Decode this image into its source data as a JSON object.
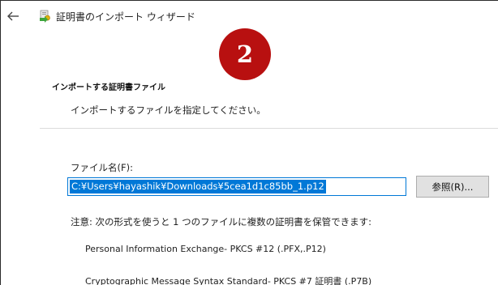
{
  "window": {
    "title": "証明書のインポート ウィザード",
    "back_icon": "back-arrow-icon",
    "app_icon": "certificate-wizard-icon"
  },
  "step_badge": {
    "number": "2",
    "color": "#b81010"
  },
  "section": {
    "heading": "インポートする証明書ファイル",
    "description": "インポートするファイルを指定してください。"
  },
  "file": {
    "label": "ファイル名(F):",
    "value": "C:¥Users¥hayashik¥Downloads¥5cea1d1c85bb_1.p12",
    "selection_color": "#0078d7"
  },
  "browse_button": {
    "label": "参照(R)..."
  },
  "note": {
    "text": "注意: 次の形式を使うと 1 つのファイルに複数の証明書を保管できます:"
  },
  "formats": [
    "Personal Information Exchange- PKCS #12 (.PFX,.P12)",
    "Cryptographic Message Syntax Standard- PKCS #7 証明書 (.P7B)"
  ]
}
